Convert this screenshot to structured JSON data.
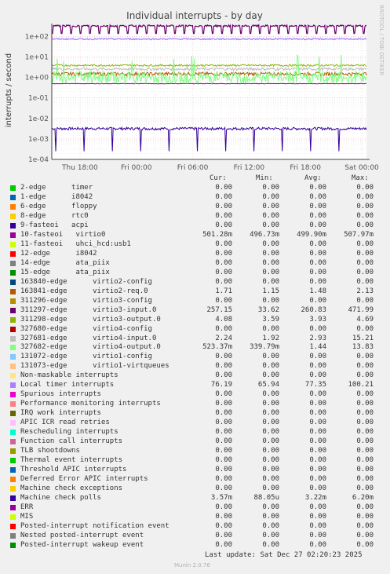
{
  "chart_data": {
    "type": "line",
    "title": "Individual interrupts - by day",
    "ylabel": "interrupts / second",
    "yscale": "log",
    "ylim": [
      0.0001,
      300
    ],
    "yticks": [
      "1e+02",
      "1e+01",
      "1e+00",
      "1e-01",
      "1e-02",
      "1e-03",
      "1e-04"
    ],
    "xticks": [
      "Thu 18:00",
      "Fri 00:00",
      "Fri 06:00",
      "Fri 12:00",
      "Fri 18:00",
      "Sat 00:00"
    ],
    "grid": true,
    "series_summary": [
      {
        "name": "10-fasteoi virtio0",
        "color": "#7a0177",
        "level": 500,
        "dips_to": 200
      },
      {
        "name": "327682-edge virtio4-output.0",
        "color": "#90ee90",
        "level": 1.2,
        "noisy": true
      },
      {
        "name": "311297-edge virtio3-input.0",
        "color": "#cc8800",
        "level": 3.9
      },
      {
        "name": "Local timer interrupts",
        "color": "#a080e0",
        "level": 75
      },
      {
        "name": "Machine check polls",
        "color": "#330099",
        "level": 0.0035,
        "dips_to": 0.0002
      },
      {
        "name": "163841-edge virtio2-req.0",
        "color": "#b35806",
        "level": 1.5
      }
    ]
  },
  "side_label": "RRDTOOL / TOBI OETIKER",
  "legend_headers": {
    "cur": "Cur:",
    "min": "Min:",
    "avg": "Avg:",
    "max": "Max:"
  },
  "legend_rows": [
    {
      "label": "2-edge      timer",
      "color": "#00cc00",
      "cur": "0.00",
      "min": "0.00",
      "avg": "0.00",
      "max": "0.00"
    },
    {
      "label": "1-edge      i8042",
      "color": "#0066b3",
      "cur": "0.00",
      "min": "0.00",
      "avg": "0.00",
      "max": "0.00"
    },
    {
      "label": "6-edge      floppy",
      "color": "#ff8000",
      "cur": "0.00",
      "min": "0.00",
      "avg": "0.00",
      "max": "0.00"
    },
    {
      "label": "8-edge      rtc0",
      "color": "#ffcc00",
      "cur": "0.00",
      "min": "0.00",
      "avg": "0.00",
      "max": "0.00"
    },
    {
      "label": "9-fasteoi   acpi",
      "color": "#330099",
      "cur": "0.00",
      "min": "0.00",
      "avg": "0.00",
      "max": "0.00"
    },
    {
      "label": "10-fasteoi   virtio0",
      "color": "#990099",
      "cur": "501.28m",
      "min": "496.73m",
      "avg": "499.90m",
      "max": "507.97m"
    },
    {
      "label": "11-fasteoi   uhci_hcd:usb1",
      "color": "#ccff00",
      "cur": "0.00",
      "min": "0.00",
      "avg": "0.00",
      "max": "0.00"
    },
    {
      "label": "12-edge      i8042",
      "color": "#ff0000",
      "cur": "0.00",
      "min": "0.00",
      "avg": "0.00",
      "max": "0.00"
    },
    {
      "label": "14-edge      ata_piix",
      "color": "#808080",
      "cur": "0.00",
      "min": "0.00",
      "avg": "0.00",
      "max": "0.00"
    },
    {
      "label": "15-edge      ata_piix",
      "color": "#008f00",
      "cur": "0.00",
      "min": "0.00",
      "avg": "0.00",
      "max": "0.00"
    },
    {
      "label": "163840-edge      virtio2-config",
      "color": "#00487d",
      "cur": "0.00",
      "min": "0.00",
      "avg": "0.00",
      "max": "0.00"
    },
    {
      "label": "163841-edge      virtio2-req.0",
      "color": "#b35a00",
      "cur": "1.71",
      "min": "1.15",
      "avg": "1.48",
      "max": "2.13"
    },
    {
      "label": "311296-edge      virtio3-config",
      "color": "#b38f00",
      "cur": "0.00",
      "min": "0.00",
      "avg": "0.00",
      "max": "0.00"
    },
    {
      "label": "311297-edge      virtio3-input.0",
      "color": "#6b006b",
      "cur": "257.15",
      "min": "33.62",
      "avg": "260.83",
      "max": "471.99"
    },
    {
      "label": "311298-edge      virtio3-output.0",
      "color": "#8fb300",
      "cur": "4.08",
      "min": "3.59",
      "avg": "3.93",
      "max": "4.69"
    },
    {
      "label": "327680-edge      virtio4-config",
      "color": "#b30000",
      "cur": "0.00",
      "min": "0.00",
      "avg": "0.00",
      "max": "0.00"
    },
    {
      "label": "327681-edge      virtio4-input.0",
      "color": "#bebebe",
      "cur": "2.24",
      "min": "1.92",
      "avg": "2.93",
      "max": "15.21"
    },
    {
      "label": "327682-edge      virtio4-output.0",
      "color": "#80ff80",
      "cur": "523.37m",
      "min": "339.79m",
      "avg": "1.44",
      "max": "13.83"
    },
    {
      "label": "131072-edge      virtio1-config",
      "color": "#80c9ff",
      "cur": "0.00",
      "min": "0.00",
      "avg": "0.00",
      "max": "0.00"
    },
    {
      "label": "131073-edge      virtio1-virtqueues",
      "color": "#ffc080",
      "cur": "0.00",
      "min": "0.00",
      "avg": "0.00",
      "max": "0.00"
    },
    {
      "label": "Non-maskable interrupts",
      "color": "#ffe680",
      "cur": "0.00",
      "min": "0.00",
      "avg": "0.00",
      "max": "0.00"
    },
    {
      "label": "Local timer interrupts",
      "color": "#aa80ff",
      "cur": "76.19",
      "min": "65.94",
      "avg": "77.35",
      "max": "100.21"
    },
    {
      "label": "Spurious interrupts",
      "color": "#ee00cc",
      "cur": "0.00",
      "min": "0.00",
      "avg": "0.00",
      "max": "0.00"
    },
    {
      "label": "Performance monitoring interrupts",
      "color": "#ff8080",
      "cur": "0.00",
      "min": "0.00",
      "avg": "0.00",
      "max": "0.00"
    },
    {
      "label": "IRQ work interrupts",
      "color": "#666600",
      "cur": "0.00",
      "min": "0.00",
      "avg": "0.00",
      "max": "0.00"
    },
    {
      "label": "APIC ICR read retries",
      "color": "#ffbfff",
      "cur": "0.00",
      "min": "0.00",
      "avg": "0.00",
      "max": "0.00"
    },
    {
      "label": "Rescheduling interrupts",
      "color": "#00ffcc",
      "cur": "0.00",
      "min": "0.00",
      "avg": "0.00",
      "max": "0.00"
    },
    {
      "label": "Function call interrupts",
      "color": "#cc6699",
      "cur": "0.00",
      "min": "0.00",
      "avg": "0.00",
      "max": "0.00"
    },
    {
      "label": "TLB shootdowns",
      "color": "#999900",
      "cur": "0.00",
      "min": "0.00",
      "avg": "0.00",
      "max": "0.00"
    },
    {
      "label": "Thermal event interrupts",
      "color": "#00cc00",
      "cur": "0.00",
      "min": "0.00",
      "avg": "0.00",
      "max": "0.00"
    },
    {
      "label": "Threshold APIC interrupts",
      "color": "#0066b3",
      "cur": "0.00",
      "min": "0.00",
      "avg": "0.00",
      "max": "0.00"
    },
    {
      "label": "Deferred Error APIC interrupts",
      "color": "#ff8000",
      "cur": "0.00",
      "min": "0.00",
      "avg": "0.00",
      "max": "0.00"
    },
    {
      "label": "Machine check exceptions",
      "color": "#ffcc00",
      "cur": "0.00",
      "min": "0.00",
      "avg": "0.00",
      "max": "0.00"
    },
    {
      "label": "Machine check polls",
      "color": "#330099",
      "cur": "3.57m",
      "min": "88.05u",
      "avg": "3.22m",
      "max": "6.20m"
    },
    {
      "label": "ERR",
      "color": "#990099",
      "cur": "0.00",
      "min": "0.00",
      "avg": "0.00",
      "max": "0.00"
    },
    {
      "label": "MIS",
      "color": "#ccff00",
      "cur": "0.00",
      "min": "0.00",
      "avg": "0.00",
      "max": "0.00"
    },
    {
      "label": "Posted-interrupt notification event",
      "color": "#ff0000",
      "cur": "0.00",
      "min": "0.00",
      "avg": "0.00",
      "max": "0.00"
    },
    {
      "label": "Nested posted-interrupt event",
      "color": "#808080",
      "cur": "0.00",
      "min": "0.00",
      "avg": "0.00",
      "max": "0.00"
    },
    {
      "label": "Posted-interrupt wakeup event",
      "color": "#008f00",
      "cur": "0.00",
      "min": "0.00",
      "avg": "0.00",
      "max": "0.00"
    }
  ],
  "footer": {
    "last_update": "Last update: Sat Dec 27 02:20:23 2025",
    "munin": "Munin 2.0.76"
  }
}
